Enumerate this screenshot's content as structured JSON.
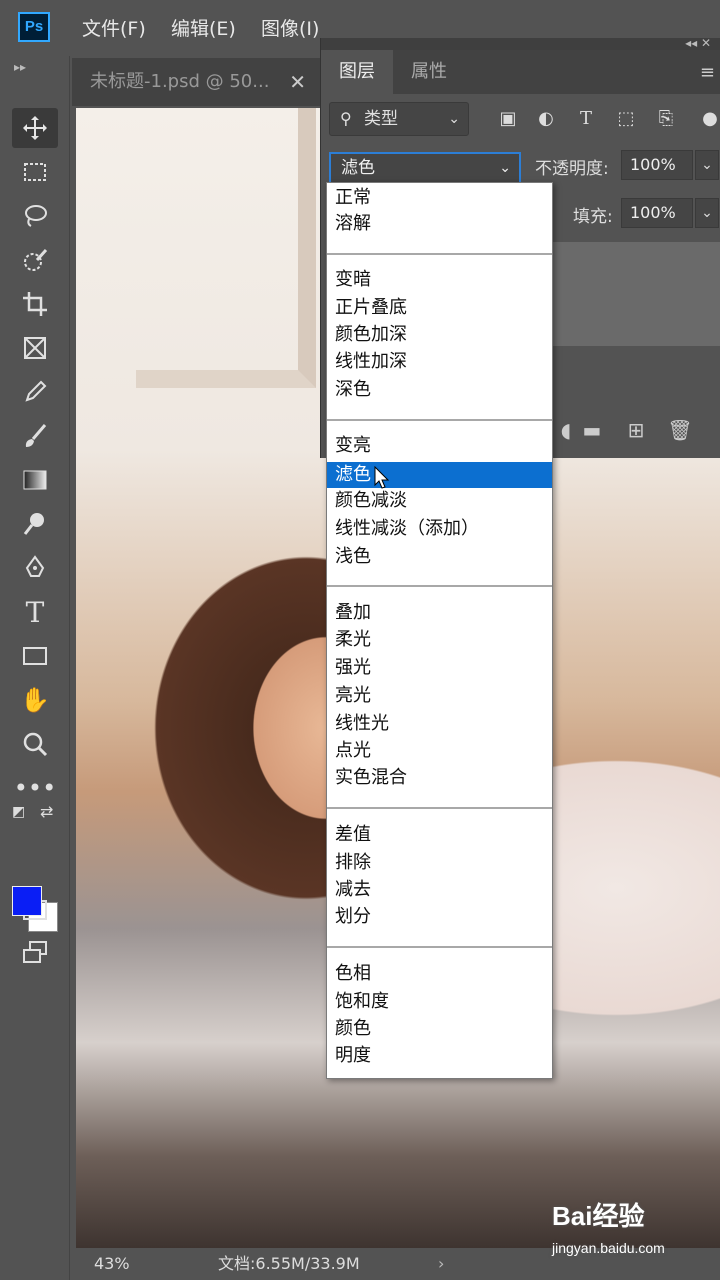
{
  "app": {
    "logo_text": "Ps"
  },
  "menu": [
    {
      "label": "文件(F)"
    },
    {
      "label": "编辑(E)"
    },
    {
      "label": "图像(I)"
    }
  ],
  "document": {
    "tab_title": "未标题-1.psd @ 50...",
    "zoom": "43%",
    "doc_info": "文档:6.55M/33.9M"
  },
  "colors": {
    "foreground": "#0a1ef5",
    "background": "#ffffff",
    "accent": "#0c6fd0"
  },
  "tools": [
    "move-icon",
    "marquee-icon",
    "lasso-icon",
    "quick-select-icon",
    "crop-icon",
    "frame-icon",
    "eyedropper-icon",
    "brush-icon",
    "gradient-icon",
    "dodge-icon",
    "pen-icon",
    "type-icon",
    "rectangle-icon",
    "hand-icon",
    "zoom-icon",
    "more-icon"
  ],
  "layers_panel": {
    "tabs": [
      "图层",
      "属性"
    ],
    "filter_label": "类型",
    "blend_mode": "滤色",
    "opacity_label": "不透明度:",
    "opacity_value": "100%",
    "fill_label": "填充:",
    "fill_value": "100%"
  },
  "blend_modes": {
    "group1": [
      "正常",
      "溶解"
    ],
    "group2": [
      "变暗",
      "正片叠底",
      "颜色加深",
      "线性加深",
      "深色"
    ],
    "group3": [
      "变亮",
      "滤色",
      "颜色减淡",
      "线性减淡（添加）",
      "浅色"
    ],
    "group4": [
      "叠加",
      "柔光",
      "强光",
      "亮光",
      "线性光",
      "点光",
      "实色混合"
    ],
    "group5": [
      "差值",
      "排除",
      "减去",
      "划分"
    ],
    "group6": [
      "色相",
      "饱和度",
      "颜色",
      "明度"
    ],
    "selected": "滤色"
  },
  "watermark": {
    "brand": "Bai经验",
    "url": "jingyan.baidu.com"
  }
}
